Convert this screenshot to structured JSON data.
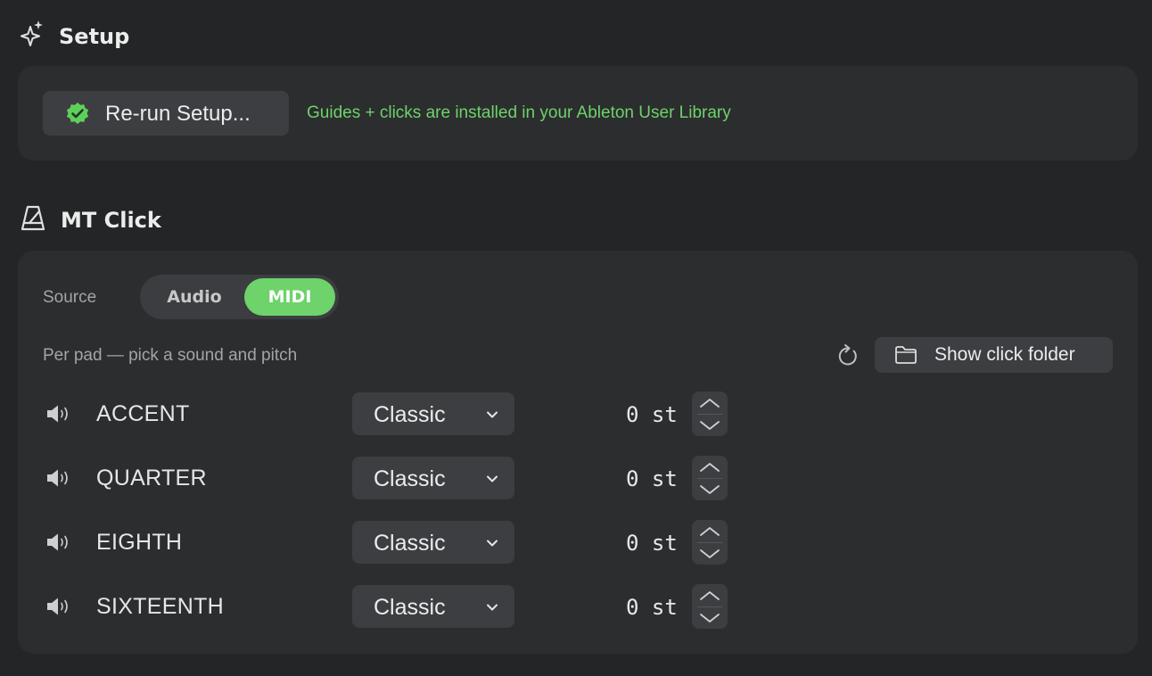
{
  "setup": {
    "title": "Setup",
    "rerun_label": "Re-run Setup...",
    "status_text": "Guides + clicks are installed in your Ableton User Library"
  },
  "mt_click": {
    "title": "MT Click",
    "source_label": "Source",
    "source_options": [
      "Audio",
      "MIDI"
    ],
    "source_selected": "MIDI",
    "hint": "Per pad — pick a sound and pitch",
    "show_folder_label": "Show click folder",
    "pads": [
      {
        "name": "ACCENT",
        "sound": "Classic",
        "pitch": "0 st"
      },
      {
        "name": "QUARTER",
        "sound": "Classic",
        "pitch": "0 st"
      },
      {
        "name": "EIGHTH",
        "sound": "Classic",
        "pitch": "0 st"
      },
      {
        "name": "SIXTEENTH",
        "sound": "Classic",
        "pitch": "0 st"
      }
    ]
  },
  "colors": {
    "background": "#232527",
    "card": "#2c2d2f",
    "control": "#3d3e41",
    "accent_green": "#6dd36a"
  }
}
